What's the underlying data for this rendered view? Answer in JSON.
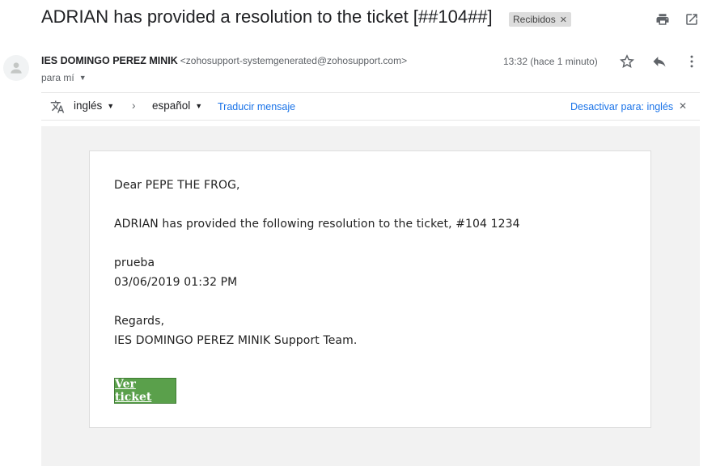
{
  "email": {
    "subject": "ADRIAN has provided a resolution to the ticket [##104##]",
    "label": "Recibidos",
    "sender_name": "IES DOMINGO PEREZ MINIK",
    "sender_email": "<zohosupport-systemgenerated@zohosupport.com>",
    "recipient": "para mí",
    "time": "13:32 (hace 1 minuto)"
  },
  "translate": {
    "source_lang": "inglés",
    "target_lang": "español",
    "translate_link": "Traducir mensaje",
    "disable_link": "Desactivar para: inglés"
  },
  "message": {
    "greeting": "Dear PEPE THE FROG,",
    "line1": "ADRIAN has provided the following resolution to the ticket, #104 1234",
    "resolution": "prueba",
    "datetime": "03/06/2019 01:32 PM",
    "regards": "Regards,",
    "team": "IES DOMINGO PEREZ MINIK Support Team.",
    "button_label": "Ver ticket"
  },
  "icons": [
    "print-icon",
    "open-new-window-icon",
    "avatar-icon",
    "star-icon",
    "reply-icon",
    "more-vert-icon",
    "translate-icon",
    "dropdown-icon",
    "chevron-right-icon",
    "close-icon"
  ],
  "colors": {
    "link": "#1a73e8",
    "button": "#5aa04b",
    "gray_bg": "#f2f2f2",
    "chip_bg": "#dddddd"
  }
}
